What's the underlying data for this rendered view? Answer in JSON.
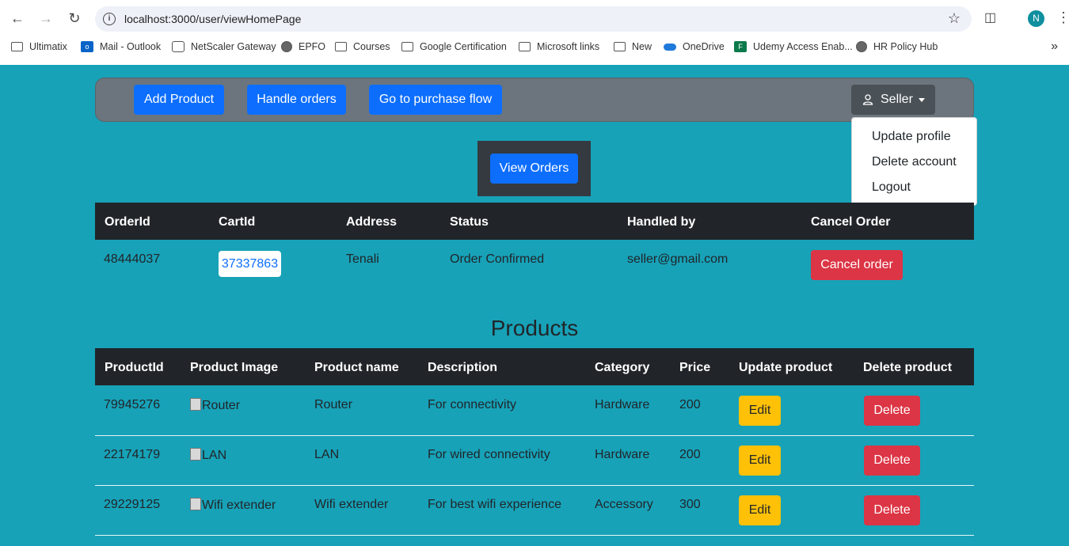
{
  "browser": {
    "url": "localhost:3000/user/viewHomePage",
    "avatar_letter": "N",
    "bookmarks": [
      {
        "label": "Ultimatix",
        "icon": "folder-icon"
      },
      {
        "label": "Mail - Outlook",
        "icon": "outlook-icon"
      },
      {
        "label": "NetScaler Gateway",
        "icon": "lock-icon"
      },
      {
        "label": "EPFO",
        "icon": "globe-icon"
      },
      {
        "label": "Courses",
        "icon": "folder-icon"
      },
      {
        "label": "Google Certification",
        "icon": "folder-icon"
      },
      {
        "label": "Microsoft links",
        "icon": "folder-icon"
      },
      {
        "label": "New",
        "icon": "folder-icon"
      },
      {
        "label": "OneDrive",
        "icon": "cloud-icon"
      },
      {
        "label": "Udemy Access Enab...",
        "icon": "forms-icon"
      },
      {
        "label": "HR Policy Hub",
        "icon": "globe-icon"
      }
    ]
  },
  "navbar": {
    "add_product": "Add Product",
    "handle_orders": "Handle orders",
    "purchase_flow": "Go to purchase flow",
    "seller": "Seller",
    "dropdown": [
      "Update profile",
      "Delete account",
      "Logout"
    ]
  },
  "orders": {
    "view_orders": "View Orders",
    "headers": [
      "OrderId",
      "CartId",
      "Address",
      "Status",
      "Handled by",
      "Cancel Order"
    ],
    "rows": [
      {
        "order_id": "48444037",
        "cart_id": "37337863",
        "address": "Tenali",
        "status": "Order Confirmed",
        "handled_by": "seller@gmail.com",
        "cancel_label": "Cancel order"
      }
    ]
  },
  "products": {
    "title": "Products",
    "headers": [
      "ProductId",
      "Product Image",
      "Product name",
      "Description",
      "Category",
      "Price",
      "Update product",
      "Delete product"
    ],
    "rows": [
      {
        "id": "79945276",
        "image_alt": "Router",
        "name": "Router",
        "description": "For connectivity",
        "category": "Hardware",
        "price": "200",
        "edit": "Edit",
        "delete": "Delete"
      },
      {
        "id": "22174179",
        "image_alt": "LAN",
        "name": "LAN",
        "description": "For wired connectivity",
        "category": "Hardware",
        "price": "200",
        "edit": "Edit",
        "delete": "Delete"
      },
      {
        "id": "29229125",
        "image_alt": "Wifi extender",
        "name": "Wifi extender",
        "description": "For best wifi experience",
        "category": "Accessory",
        "price": "300",
        "edit": "Edit",
        "delete": "Delete"
      }
    ]
  }
}
